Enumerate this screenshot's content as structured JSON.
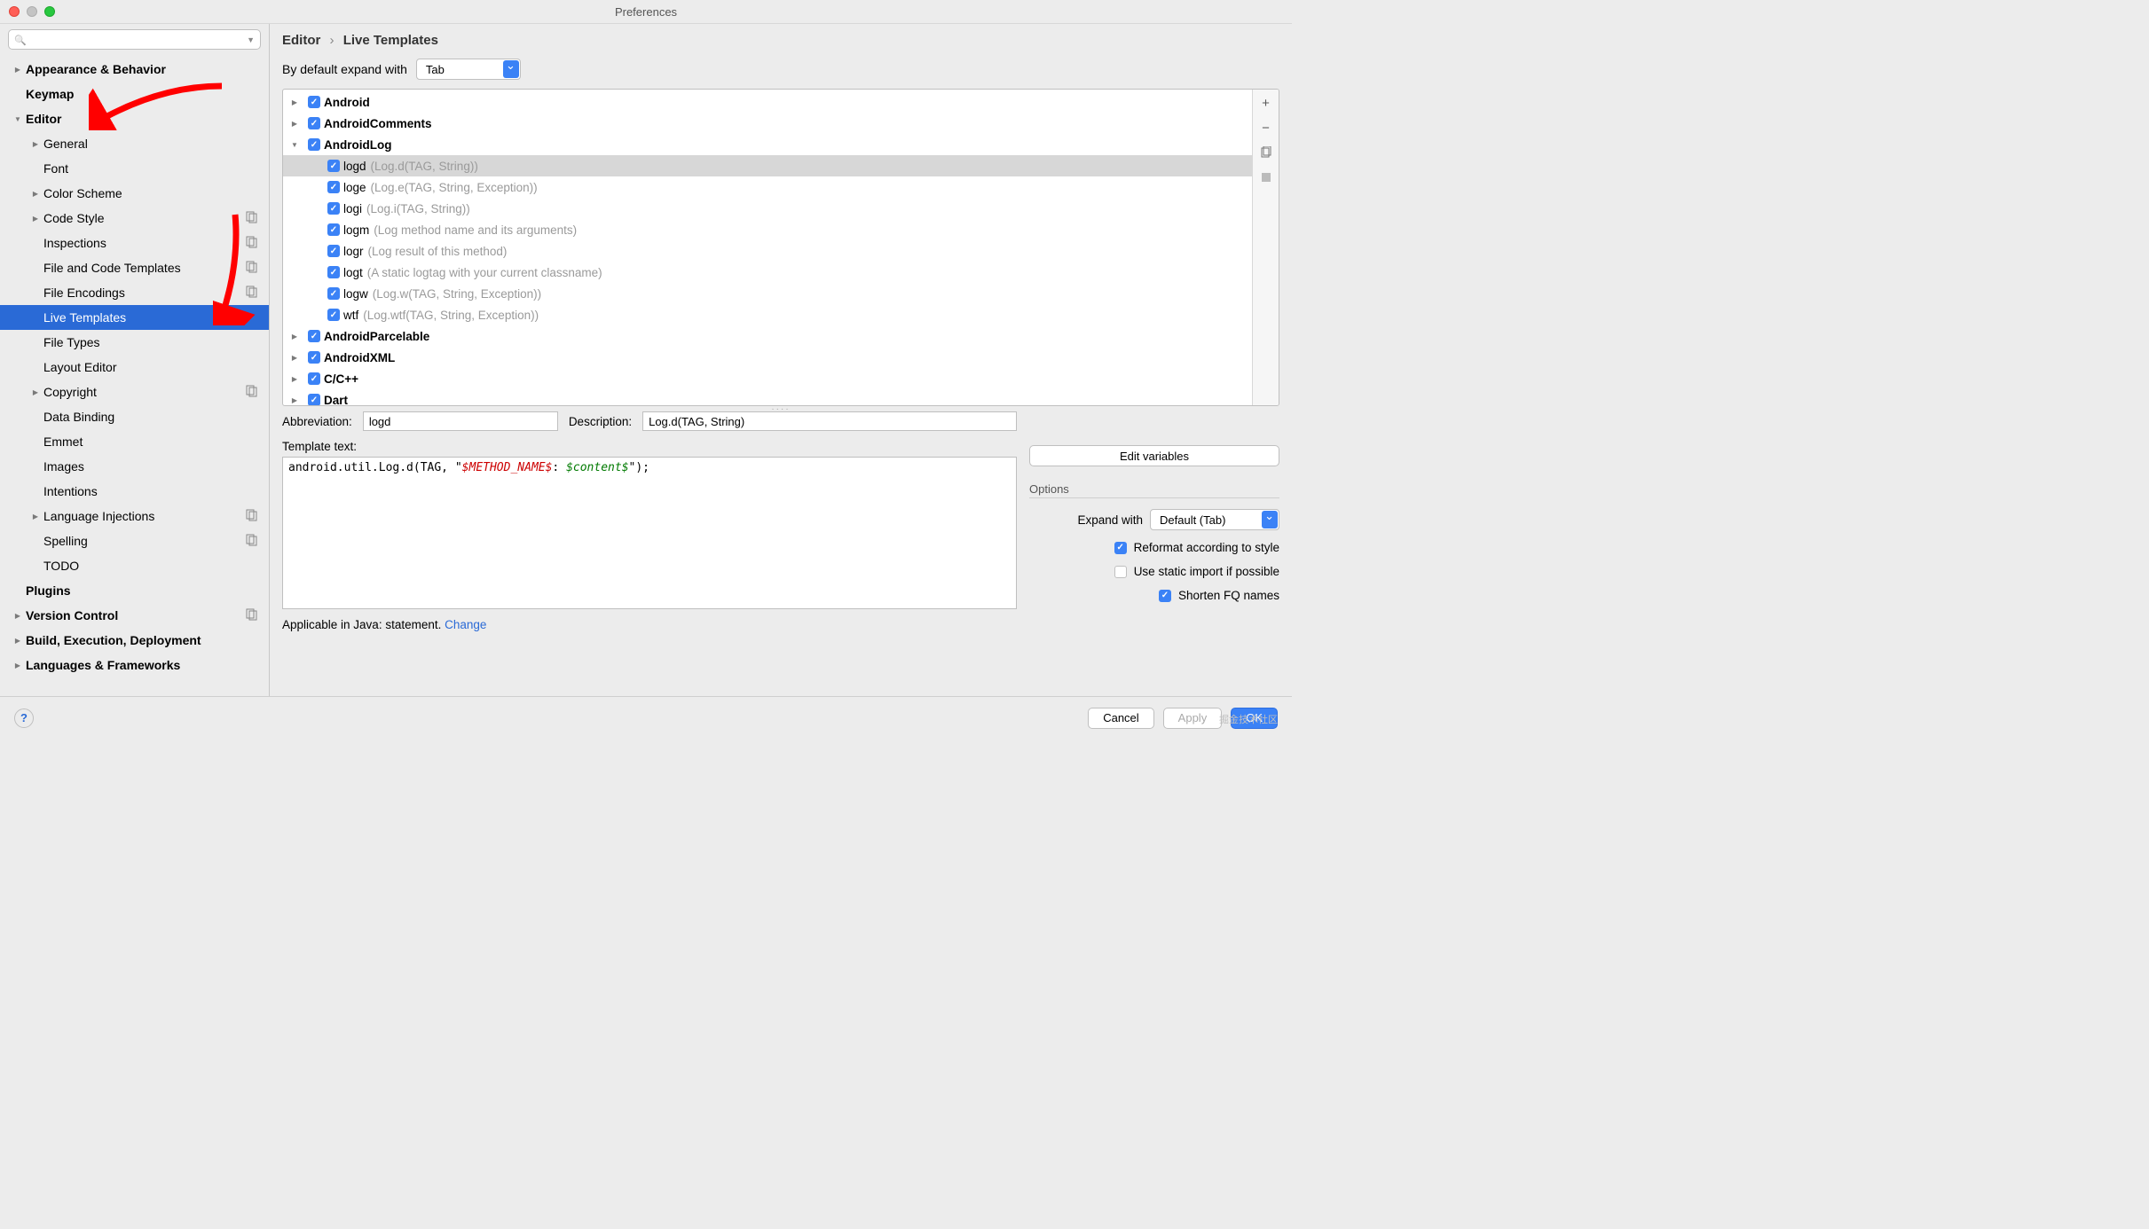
{
  "window": {
    "title": "Preferences"
  },
  "search": {
    "placeholder": ""
  },
  "breadcrumb": {
    "a": "Editor",
    "b": "Live Templates"
  },
  "expand": {
    "label": "By default expand with",
    "value": "Tab"
  },
  "sidebar": {
    "items": [
      {
        "label": "Appearance & Behavior",
        "bold": true,
        "arrow": "r",
        "indent": 0
      },
      {
        "label": "Keymap",
        "bold": true,
        "indent": 0
      },
      {
        "label": "Editor",
        "bold": true,
        "arrow": "d",
        "indent": 0
      },
      {
        "label": "General",
        "arrow": "r",
        "indent": 1
      },
      {
        "label": "Font",
        "indent": 1
      },
      {
        "label": "Color Scheme",
        "arrow": "r",
        "indent": 1
      },
      {
        "label": "Code Style",
        "arrow": "r",
        "indent": 1,
        "ov": true
      },
      {
        "label": "Inspections",
        "indent": 1,
        "ov": true
      },
      {
        "label": "File and Code Templates",
        "indent": 1,
        "ov": true
      },
      {
        "label": "File Encodings",
        "indent": 1,
        "ov": true
      },
      {
        "label": "Live Templates",
        "indent": 1,
        "selected": true
      },
      {
        "label": "File Types",
        "indent": 1
      },
      {
        "label": "Layout Editor",
        "indent": 1
      },
      {
        "label": "Copyright",
        "arrow": "r",
        "indent": 1,
        "ov": true
      },
      {
        "label": "Data Binding",
        "indent": 1
      },
      {
        "label": "Emmet",
        "indent": 1
      },
      {
        "label": "Images",
        "indent": 1
      },
      {
        "label": "Intentions",
        "indent": 1
      },
      {
        "label": "Language Injections",
        "arrow": "r",
        "indent": 1,
        "ov": true
      },
      {
        "label": "Spelling",
        "indent": 1,
        "ov": true
      },
      {
        "label": "TODO",
        "indent": 1
      },
      {
        "label": "Plugins",
        "bold": true,
        "indent": 0
      },
      {
        "label": "Version Control",
        "bold": true,
        "arrow": "r",
        "indent": 0,
        "ov": true
      },
      {
        "label": "Build, Execution, Deployment",
        "bold": true,
        "arrow": "r",
        "indent": 0
      },
      {
        "label": "Languages & Frameworks",
        "bold": true,
        "arrow": "r",
        "indent": 0
      }
    ]
  },
  "templates": {
    "groups": [
      {
        "name": "Android",
        "arrow": "r"
      },
      {
        "name": "AndroidComments",
        "arrow": "r"
      },
      {
        "name": "AndroidLog",
        "arrow": "d",
        "items": [
          {
            "abv": "logd",
            "desc": "(Log.d(TAG, String))",
            "selected": true
          },
          {
            "abv": "loge",
            "desc": "(Log.e(TAG, String, Exception))"
          },
          {
            "abv": "logi",
            "desc": "(Log.i(TAG, String))"
          },
          {
            "abv": "logm",
            "desc": "(Log method name and its arguments)"
          },
          {
            "abv": "logr",
            "desc": "(Log result of this method)"
          },
          {
            "abv": "logt",
            "desc": "(A static logtag with your current classname)"
          },
          {
            "abv": "logw",
            "desc": "(Log.w(TAG, String, Exception))"
          },
          {
            "abv": "wtf",
            "desc": "(Log.wtf(TAG, String, Exception))"
          }
        ]
      },
      {
        "name": "AndroidParcelable",
        "arrow": "r"
      },
      {
        "name": "AndroidXML",
        "arrow": "r"
      },
      {
        "name": "C/C++",
        "arrow": "r"
      },
      {
        "name": "Dart",
        "arrow": "r"
      }
    ]
  },
  "detail": {
    "abv_label": "Abbreviation:",
    "abv_value": "logd",
    "desc_label": "Description:",
    "desc_value": "Log.d(TAG, String)",
    "ttext_label": "Template text:",
    "ttext_prefix": "android.util.Log.d(TAG, \"",
    "ttext_var1": "$METHOD_NAME$",
    "ttext_sep": ": ",
    "ttext_var2": "$content$",
    "ttext_suffix": "\");",
    "editvars": "Edit variables",
    "options_label": "Options",
    "expand_with_label": "Expand with",
    "expand_with_value": "Default (Tab)",
    "reformat": "Reformat according to style",
    "staticimp": "Use static import if possible",
    "shortenfq": "Shorten FQ names",
    "applicable_prefix": "Applicable in Java: statement. ",
    "change": "Change"
  },
  "footer": {
    "cancel": "Cancel",
    "apply": "Apply",
    "ok": "OK"
  },
  "watermark": "掘金技术社区"
}
